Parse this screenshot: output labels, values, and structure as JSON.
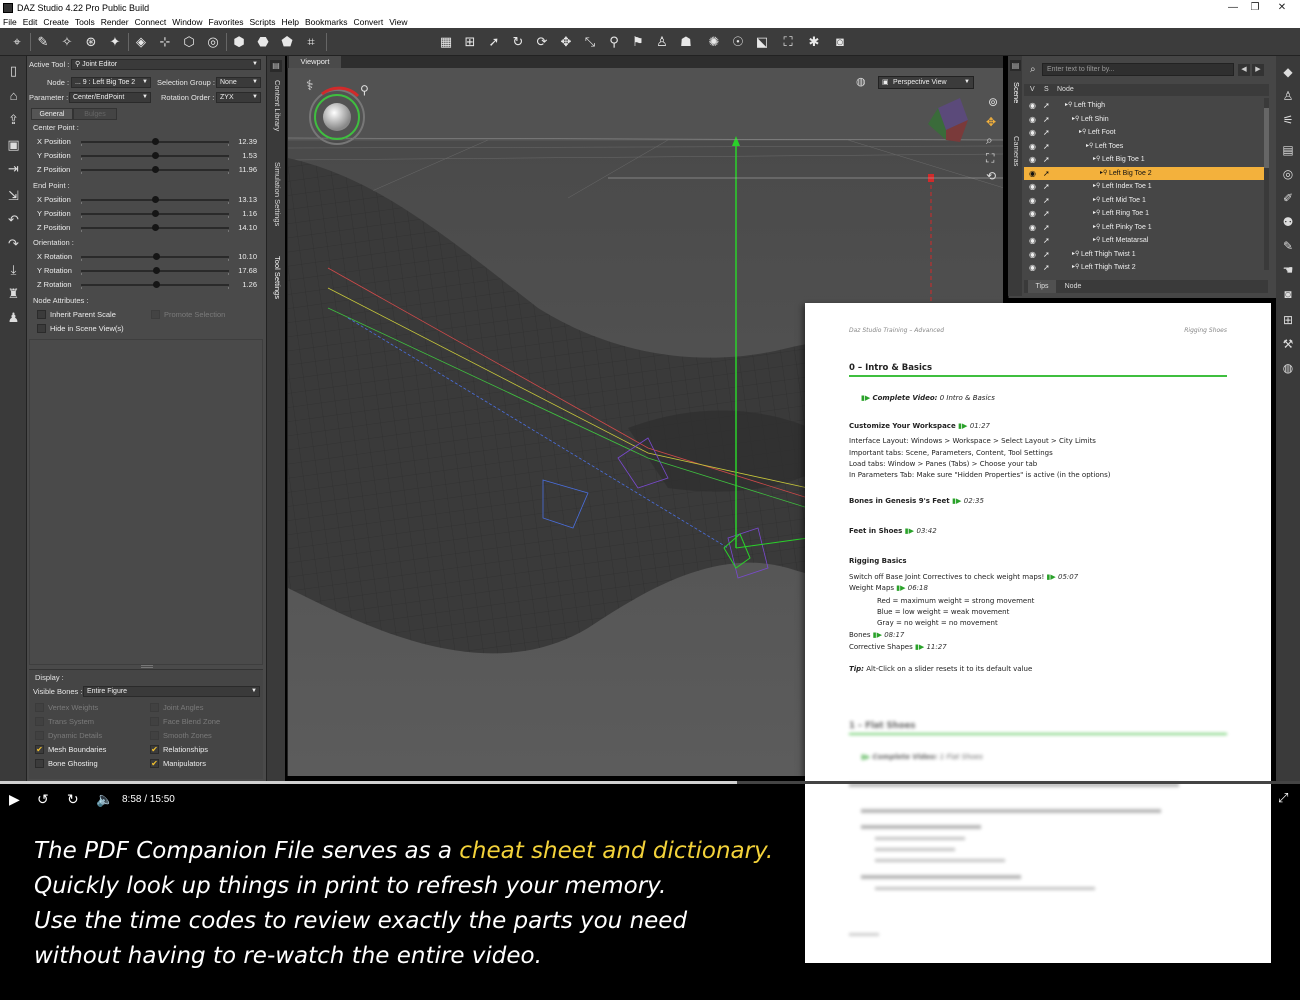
{
  "window": {
    "title": "DAZ Studio 4.22 Pro Public Build",
    "controls": [
      "—",
      "❐",
      "✕"
    ]
  },
  "menu": [
    "File",
    "Edit",
    "Create",
    "Tools",
    "Render",
    "Connect",
    "Window",
    "Favorites",
    "Scripts",
    "Help",
    "Bookmarks",
    "Convert",
    "View"
  ],
  "tool_settings": {
    "active_tool_label": "Active Tool :",
    "active_tool": "Joint Editor",
    "node_label": "Node :",
    "node": "... 9 : Left Big Toe 2",
    "selection_group_label": "Selection Group :",
    "selection_group": "None",
    "parameter_label": "Parameter :",
    "parameter": "Center/EndPoint",
    "rotation_order_label": "Rotation Order :",
    "rotation_order": "ZYX",
    "tabs": [
      "General",
      "Bulges"
    ],
    "center_point": {
      "label": "Center Point :",
      "rows": [
        {
          "label": "X Position",
          "value": "12.39",
          "pos": 0.5
        },
        {
          "label": "Y Position",
          "value": "1.53",
          "pos": 0.5
        },
        {
          "label": "Z Position",
          "value": "11.96",
          "pos": 0.5
        }
      ]
    },
    "end_point": {
      "label": "End Point :",
      "rows": [
        {
          "label": "X Position",
          "value": "13.13",
          "pos": 0.5
        },
        {
          "label": "Y Position",
          "value": "1.16",
          "pos": 0.5
        },
        {
          "label": "Z Position",
          "value": "14.10",
          "pos": 0.5
        }
      ]
    },
    "orientation": {
      "label": "Orientation :",
      "rows": [
        {
          "label": "X Rotation",
          "value": "10.10",
          "pos": 0.51
        },
        {
          "label": "Y Rotation",
          "value": "17.68",
          "pos": 0.51
        },
        {
          "label": "Z Rotation",
          "value": "1.26",
          "pos": 0.51
        }
      ]
    },
    "node_attributes": {
      "label": "Node Attributes :",
      "inherit_parent_scale": "Inherit Parent Scale",
      "hide_in_scene": "Hide in Scene View(s)",
      "promote_selection": "Promote Selection"
    },
    "display": {
      "label": "Display :",
      "visible_bones_label": "Visible Bones :",
      "visible_bones": "Entire Figure",
      "options_dim": [
        "Vertex Weights",
        "Joint Angles",
        "Trans System",
        "Face Blend Zone",
        "Dynamic Details",
        "Smooth Zones"
      ],
      "mesh_boundaries": "Mesh Boundaries",
      "relationships": "Relationships",
      "bone_ghosting": "Bone Ghosting",
      "manipulators": "Manipulators"
    }
  },
  "side_tabs": [
    "Content Library",
    "Simulation Settings",
    "Tool Settings"
  ],
  "viewport": {
    "tab": "Viewport",
    "camera": "Perspective View"
  },
  "scene": {
    "side_tabs": [
      "Scene",
      "Cameras"
    ],
    "filter_placeholder": "Enter text to filter by...",
    "columns": [
      "V",
      "S",
      "Node"
    ],
    "nodes": [
      {
        "name": "Left Thigh",
        "indent": 0,
        "selected": false
      },
      {
        "name": "Left Shin",
        "indent": 1,
        "selected": false
      },
      {
        "name": "Left Foot",
        "indent": 2,
        "selected": false
      },
      {
        "name": "Left Toes",
        "indent": 3,
        "selected": false
      },
      {
        "name": "Left Big Toe 1",
        "indent": 4,
        "selected": false
      },
      {
        "name": "Left Big Toe 2",
        "indent": 5,
        "selected": true
      },
      {
        "name": "Left Index Toe 1",
        "indent": 4,
        "selected": false
      },
      {
        "name": "Left Mid Toe 1",
        "indent": 4,
        "selected": false
      },
      {
        "name": "Left Ring Toe 1",
        "indent": 4,
        "selected": false
      },
      {
        "name": "Left Pinky Toe 1",
        "indent": 4,
        "selected": false
      },
      {
        "name": "Left Metatarsal",
        "indent": 4,
        "selected": false
      },
      {
        "name": "Left Thigh Twist 1",
        "indent": 1,
        "selected": false
      },
      {
        "name": "Left Thigh Twist 2",
        "indent": 1,
        "selected": false
      }
    ],
    "bottom_tabs": [
      "Tips",
      "Node"
    ]
  },
  "pdf": {
    "header_left": "Daz Studio Training – Advanced",
    "header_right": "Rigging Shoes",
    "section0_title": "0 – Intro & Basics",
    "complete_video_label": "Complete Video:",
    "complete_video_0": "0 Intro & Basics",
    "customize_title": "Customize Your Workspace",
    "customize_time": "01:27",
    "customize_lines": [
      "Interface Layout: Windows > Workspace > Select Layout > City Limits",
      "Important tabs: Scene, Parameters, Content, Tool Settings",
      "Load tabs: Window > Panes (Tabs) > Choose your tab",
      "In Parameters Tab: Make sure \"Hidden Properties\" is active (in the options)"
    ],
    "bones_title": "Bones in Genesis 9's Feet",
    "bones_time": "02:35",
    "feet_title": "Feet in Shoes",
    "feet_time": "03:42",
    "rigging_title": "Rigging Basics",
    "switch_off": "Switch off Base Joint Correctives to check weight maps!",
    "switch_time": "05:07",
    "weight_maps": "Weight Maps",
    "weight_time": "06:18",
    "red": "Red = maximum weight = strong movement",
    "blue": "Blue = low weight = weak movement",
    "gray": "Gray = no weight = no movement",
    "bones_label": "Bones",
    "bones_label_time": "08:17",
    "corrective": "Corrective Shapes",
    "corrective_time": "11:27",
    "tip_label": "Tip:",
    "tip": "Alt-Click on a slider resets it to its default value",
    "section1_title": "1 – Flat Shoes",
    "complete_video_1": "1 Flat Shoes"
  },
  "video": {
    "time": "8:58 / 15:50",
    "progress": 0.567
  },
  "caption": {
    "line1_a": "The PDF Companion File serves as a ",
    "line1_hl": "cheat sheet and dictionary.",
    "line2": "Quickly look up things in print to refresh your memory.",
    "line3": "Use the time codes to review exactly the parts you need",
    "line4": "without having to re-watch the entire video."
  },
  "colors": {
    "highlight": "#f3d23a",
    "selection": "#f3b13c",
    "accent_green": "#3fbf3f"
  }
}
